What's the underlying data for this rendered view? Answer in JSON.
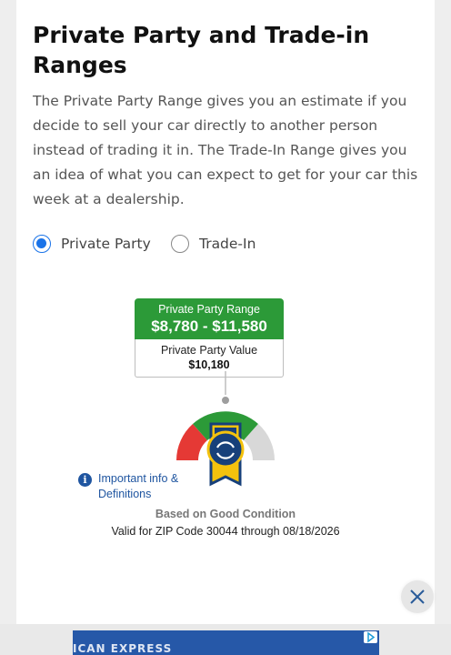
{
  "section": {
    "title": "Private Party and Trade-in Ranges",
    "description": "The Private Party Range gives you an estimate if you decide to sell your car directly to another person instead of trading it in. The Trade-In Range gives you an idea of what you can expect to get for your car this week at a dealership."
  },
  "options": {
    "private_party": "Private Party",
    "trade_in": "Trade-In",
    "selected": "Private Party"
  },
  "range": {
    "label": "Private Party Range",
    "value": "$8,780 - $11,580",
    "value_label": "Private Party Value",
    "value_amount": "$10,180"
  },
  "gauge": {
    "segments": [
      "red",
      "green",
      "gray"
    ],
    "colors": {
      "red": "#e53935",
      "green": "#2c9a38",
      "gray": "#d8d8d8",
      "badge": "#17407a",
      "ribbon": "#f4c20d"
    }
  },
  "info": {
    "label": "Important info & Definitions"
  },
  "condition": "Based on Good Condition",
  "validity": "Valid for ZIP Code 30044 through 08/18/2026",
  "ad": {
    "text": "ICAN EXPRESS"
  },
  "colors": {
    "accent": "#1a73e8",
    "link": "#1f55a0"
  }
}
